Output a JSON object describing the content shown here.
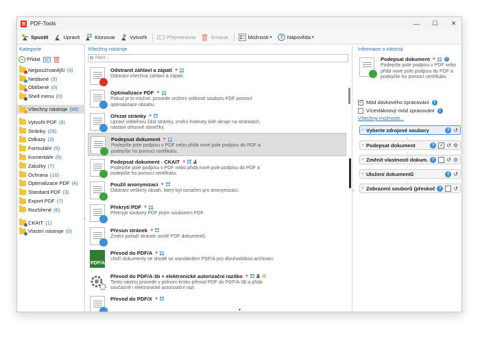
{
  "window": {
    "title": "PDF-Tools",
    "controls": {
      "minimize": "—",
      "maximize": "☐",
      "close": "✕"
    }
  },
  "toolbar": {
    "items": [
      {
        "label": "Spustit",
        "icon": "run-icon",
        "state": "bold"
      },
      {
        "label": "Upravit",
        "icon": "edit-icon",
        "state": "normal"
      },
      {
        "label": "Klonovat",
        "icon": "clone-icon",
        "state": "normal"
      },
      {
        "label": "Vytvořit",
        "icon": "create-icon",
        "state": "normal"
      },
      {
        "label": "Přejmenovat",
        "icon": "rename-icon",
        "state": "disabled"
      },
      {
        "label": "Smazat",
        "icon": "trash-icon",
        "state": "disabled"
      },
      {
        "label": "Možnosti",
        "icon": "options-icon",
        "state": "dropdown"
      },
      {
        "label": "Nápověda",
        "icon": "help-icon",
        "state": "dropdown"
      }
    ]
  },
  "left": {
    "header": "Kategorie",
    "add_label": "Přidat",
    "groups": [
      [
        {
          "label": "Nejpoužívanější",
          "count": "(3)",
          "icon": "folder-recent-icon"
        },
        {
          "label": "Nedávné",
          "count": "(3)",
          "icon": "folder-clock-icon"
        },
        {
          "label": "Oblíbené",
          "count": "(0)",
          "icon": "folder-heart-icon"
        },
        {
          "label": "Shell menu",
          "count": "(0)",
          "icon": "folder-shell-icon"
        }
      ],
      [
        {
          "label": "Všechny nástroje",
          "count": "(86)",
          "icon": "folder-all-icon",
          "selected": true
        }
      ],
      [
        {
          "label": "Vytvořit PDF",
          "count": "(8)",
          "icon": "folder-icon"
        },
        {
          "label": "Stránky",
          "count": "(26)",
          "icon": "folder-icon"
        },
        {
          "label": "Odkazy",
          "count": "(3)",
          "icon": "folder-icon"
        },
        {
          "label": "Formuláře",
          "count": "(5)",
          "icon": "folder-icon"
        },
        {
          "label": "Komentáře",
          "count": "(6)",
          "icon": "folder-icon"
        },
        {
          "label": "Záložky",
          "count": "(7)",
          "icon": "folder-icon"
        },
        {
          "label": "Ochrana",
          "count": "(10)",
          "icon": "folder-icon"
        },
        {
          "label": "Optimalizace PDF",
          "count": "(4)",
          "icon": "folder-icon"
        },
        {
          "label": "Standard PDF",
          "count": "(3)",
          "icon": "folder-icon"
        },
        {
          "label": "Export PDF",
          "count": "(7)",
          "icon": "folder-icon"
        },
        {
          "label": "Rozšířené",
          "count": "(6)",
          "icon": "folder-icon"
        }
      ],
      [
        {
          "label": "CKAIT",
          "count": "(1)",
          "icon": "folder-user-icon"
        },
        {
          "label": "Vlastní nástroje",
          "count": "(0)",
          "icon": "folder-user-icon"
        }
      ]
    ]
  },
  "middle": {
    "header": "Všechny nástroje",
    "search_placeholder": "Najít...",
    "tools": [
      {
        "name": "Odstranit záhlaví a zápatí",
        "desc": "Odstraní všechna záhlaví a zápatí.",
        "icon": "remove-header-icon",
        "badge": "#d9331f",
        "win": true
      },
      {
        "name": "Optimalizace PDF",
        "desc": "Pokud je to možné, provede snížení velikosti souboru PDF pomocí optimalizace obsahu.",
        "icon": "optimize-icon",
        "badge": "#3a8fd9",
        "win": true
      },
      {
        "name": "Ořezat stránky",
        "desc": "Upraví viditelnou část stránky, změní hodnoty bílé okraje na stránkách, nastaví ořezové rámečky.",
        "icon": "crop-icon",
        "badge": "#3a8fd9",
        "win": true
      },
      {
        "name": "Podepsat dokument",
        "desc": "Podepíše pole podpisu v PDF nebo přidá nové pole podpisu do PDF a podepíše ho pomocí certifikátu.",
        "icon": "sign-icon",
        "badge": "#3aa53a",
        "win": true,
        "selected": true
      },
      {
        "name": "Podepsat dokument - CKAIT",
        "desc": "Podepíše pole podpisu v PDF nebo přidá nové pole podpisu do PDF a podepíše ho pomocí certifikátu.",
        "icon": "sign-icon",
        "badge": "#3aa53a",
        "win": true,
        "user": true
      },
      {
        "name": "Použít anonymizaci",
        "desc": "Odstraní veškerý obsah, který byl označen pro anonymizaci.",
        "icon": "anonymize-icon",
        "badge": "#3aa53a",
        "win": true
      },
      {
        "name": "Překrytí PDF",
        "desc": "Překryje soubory PDF jiným souborem PDF.",
        "icon": "overlay-icon",
        "badge": "#3a8fd9",
        "win": true
      },
      {
        "name": "Přesun stránek",
        "desc": "Změní pořadí stránek uvnitř PDF dokumentů.",
        "icon": "move-pages-icon",
        "badge": "#3a8fd9",
        "win": true
      },
      {
        "name": "Převod do PDF/A",
        "desc": "Uloží dokumenty ve shodě se standardem PDF/A pro dlouhodobou archivaci.",
        "icon": "pdfa-icon",
        "badge": "",
        "win": true,
        "pdfa": "PDF/A"
      },
      {
        "name": "Převod do PDF/A-3b + elektronické autorizační razítko",
        "desc": "Tento nástroj provede v jednom kroku převod PDF do PDF/A-3b a přidá současně i elektronické autorizační razi",
        "icon": "gear-tool-icon",
        "badge": "",
        "win": true,
        "user": true,
        "warn": true,
        "gear": true
      },
      {
        "name": "Převod do PDF/X",
        "desc": "",
        "icon": "pdfx-icon",
        "badge": "#3a8fd9",
        "win": true
      }
    ]
  },
  "right": {
    "header": "Informace o nástroji",
    "tool_name": "Podepsat dokument",
    "tool_desc": "Podepíše pole podpisu v PDF nebo přidá nové pole podpisu do PDF a podepíše ho pomocí certifikátu.",
    "batch_mode": "Mód dávkového zpracování",
    "multithread": "Vícevláknový mód zpracování",
    "more_options": "Všechny možnosti...",
    "steps": [
      {
        "label": "Vyberte zdrojové soubory",
        "active": true
      },
      {
        "label": "Podepsat dokument"
      },
      {
        "label": "Změnit vlastnosti dokum..."
      },
      {
        "label": "Uložení dokumentů"
      },
      {
        "label": "Zobrazení souborů (přeskočit)"
      }
    ]
  }
}
